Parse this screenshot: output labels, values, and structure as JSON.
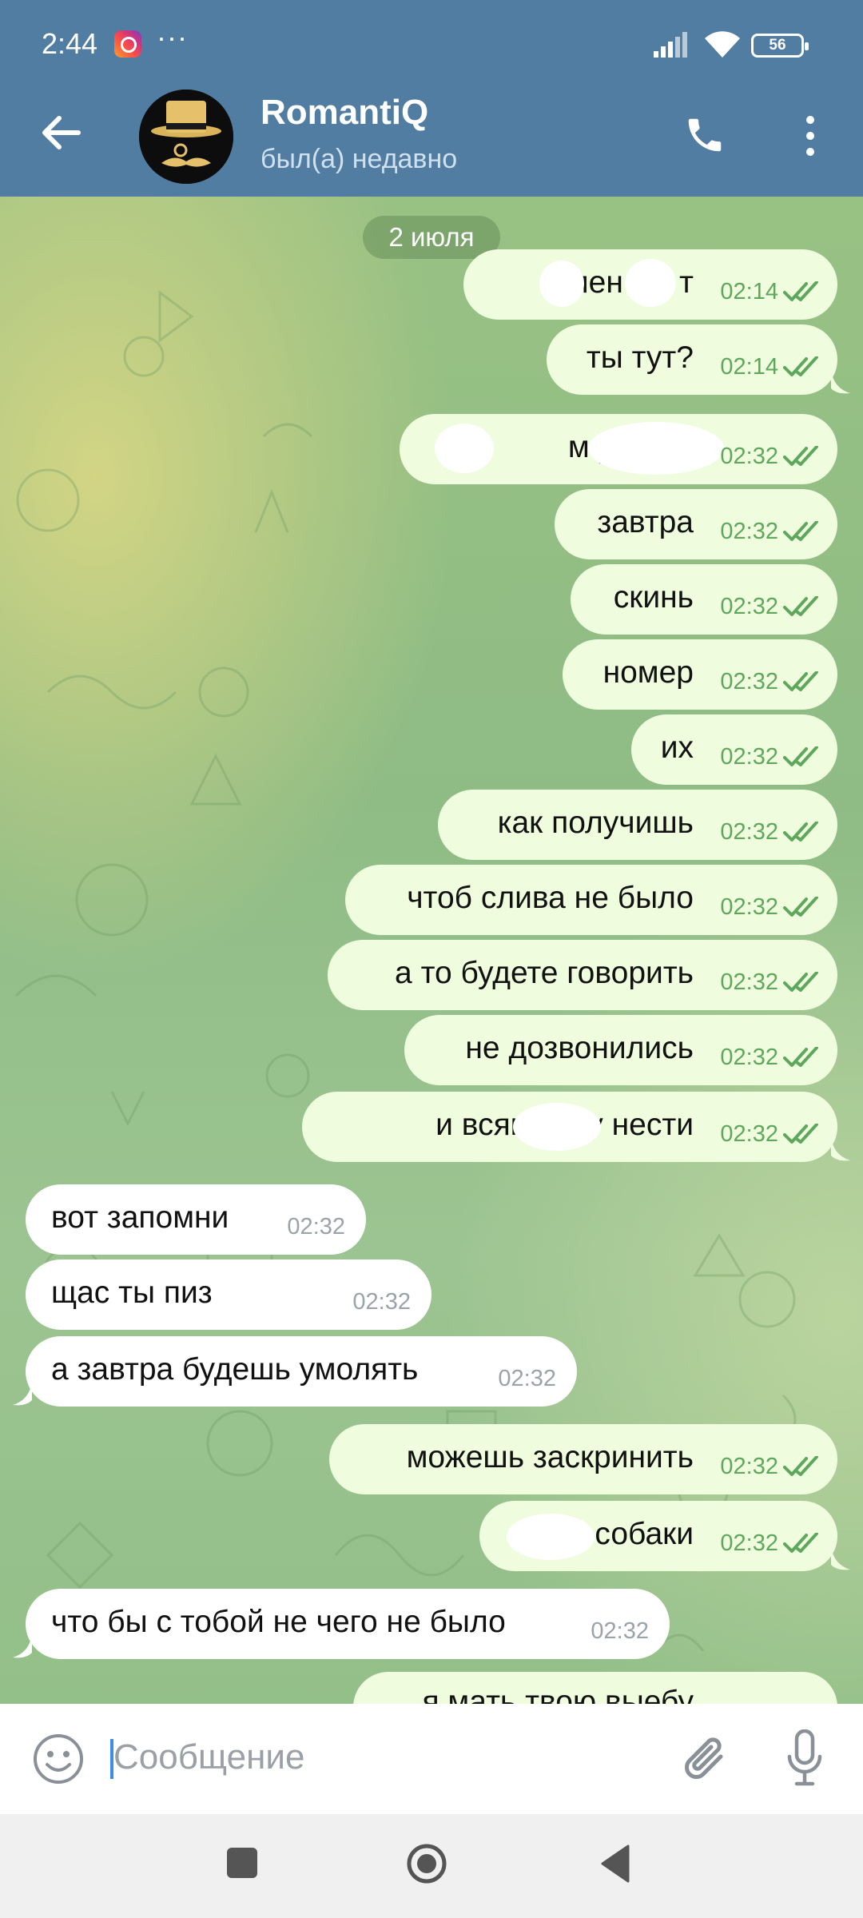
{
  "status_bar": {
    "time": "2:44",
    "more_indicator": "···",
    "battery": "56"
  },
  "header": {
    "contact_name": "RomantiQ",
    "last_seen": "был(а) недавно"
  },
  "chat": {
    "date_separator": "2 июля",
    "messages": [
      {
        "dir": "out",
        "text": "лен  ми   т",
        "time": "02:14",
        "status": "read"
      },
      {
        "dir": "out",
        "text": "ты тут?",
        "time": "02:14",
        "status": "read"
      },
      {
        "dir": "out",
        "text": "м  у твою     ",
        "time": "02:32",
        "status": "read"
      },
      {
        "dir": "out",
        "text": "завтра",
        "time": "02:32",
        "status": "read"
      },
      {
        "dir": "out",
        "text": "скинь",
        "time": "02:32",
        "status": "read"
      },
      {
        "dir": "out",
        "text": "номер",
        "time": "02:32",
        "status": "read"
      },
      {
        "dir": "out",
        "text": "их",
        "time": "02:32",
        "status": "read"
      },
      {
        "dir": "out",
        "text": "как получишь",
        "time": "02:32",
        "status": "read"
      },
      {
        "dir": "out",
        "text": "чтоб слива не было",
        "time": "02:32",
        "status": "read"
      },
      {
        "dir": "out",
        "text": "а то будете говорить",
        "time": "02:32",
        "status": "read"
      },
      {
        "dir": "out",
        "text": "не дозвонились",
        "time": "02:32",
        "status": "read"
      },
      {
        "dir": "out",
        "text": "и всякую ху     нести",
        "time": "02:32",
        "status": "read"
      },
      {
        "dir": "in",
        "text": "вот запомни",
        "time": "02:32"
      },
      {
        "dir": "in",
        "text": "щас ты пиз",
        "time": "02:32"
      },
      {
        "dir": "in",
        "text": "а завтра будешь умолять",
        "time": "02:32"
      },
      {
        "dir": "out",
        "text": "можешь заскринить",
        "time": "02:32",
        "status": "read"
      },
      {
        "dir": "out",
        "text": "с     собаки",
        "time": "02:32",
        "status": "read"
      },
      {
        "dir": "in",
        "text": "что бы с тобой не чего не было",
        "time": "02:32"
      },
      {
        "dir": "out",
        "text": "я мать твою выебу",
        "time": "",
        "status": "read"
      }
    ]
  },
  "composer": {
    "placeholder": "Сообщение",
    "value": ""
  },
  "icons": {
    "back": "arrow-left-icon",
    "call": "phone-icon",
    "menu": "more-vertical-icon",
    "emoji": "emoji-icon",
    "attach": "paperclip-icon",
    "voice": "microphone-icon",
    "read": "double-check-icon",
    "scroll": "chevron-down-icon"
  },
  "colors": {
    "header": "#517da2",
    "outgoing_bubble": "#effdde",
    "incoming_bubble": "#ffffff",
    "check": "#5fa75c"
  }
}
